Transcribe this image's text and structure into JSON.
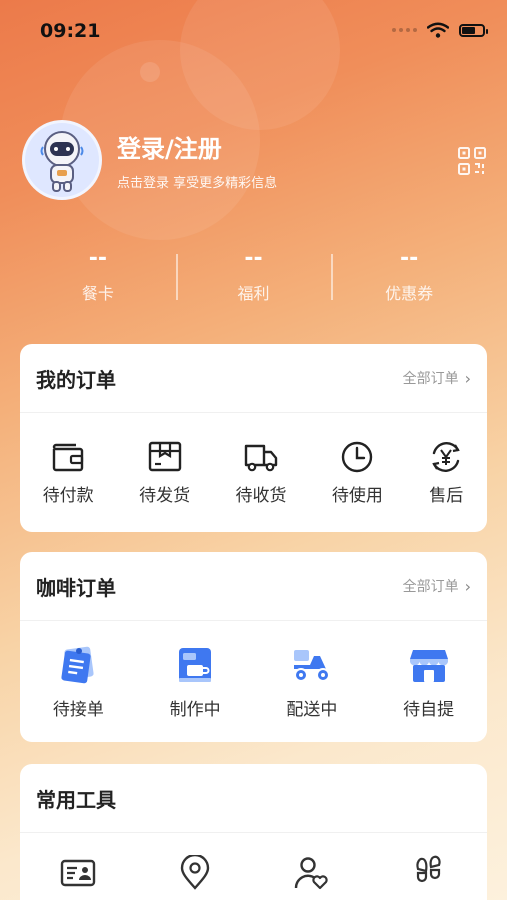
{
  "status_bar": {
    "time": "09:21",
    "battery_level": 0.7
  },
  "profile": {
    "login_label": "登录/注册",
    "subtitle": "点击登录 享受更多精彩信息",
    "avatar_icon": "astronaut-avatar",
    "qr_icon": "qr-code-icon"
  },
  "stats": [
    {
      "value": "--",
      "label": "餐卡"
    },
    {
      "value": "--",
      "label": "福利"
    },
    {
      "value": "--",
      "label": "优惠券"
    }
  ],
  "my_orders": {
    "title": "我的订单",
    "all_link": "全部订单",
    "items": [
      {
        "label": "待付款",
        "icon": "wallet-icon"
      },
      {
        "label": "待发货",
        "icon": "package-icon"
      },
      {
        "label": "待收货",
        "icon": "truck-icon"
      },
      {
        "label": "待使用",
        "icon": "clock-icon"
      },
      {
        "label": "售后",
        "icon": "yuan-refund-icon"
      }
    ]
  },
  "coffee_orders": {
    "title": "咖啡订单",
    "all_link": "全部订单",
    "items": [
      {
        "label": "待接单",
        "icon": "order-list-icon"
      },
      {
        "label": "制作中",
        "icon": "coffee-machine-icon"
      },
      {
        "label": "配送中",
        "icon": "scooter-icon"
      },
      {
        "label": "待自提",
        "icon": "store-icon"
      }
    ]
  },
  "tools": {
    "title": "常用工具",
    "items": [
      {
        "icon": "id-card-icon"
      },
      {
        "icon": "location-pin-icon"
      },
      {
        "icon": "user-heart-icon"
      },
      {
        "icon": "footprints-icon"
      }
    ]
  },
  "colors": {
    "accent_blue": "#3f78f0",
    "header_orange": "#ec7a4a"
  }
}
